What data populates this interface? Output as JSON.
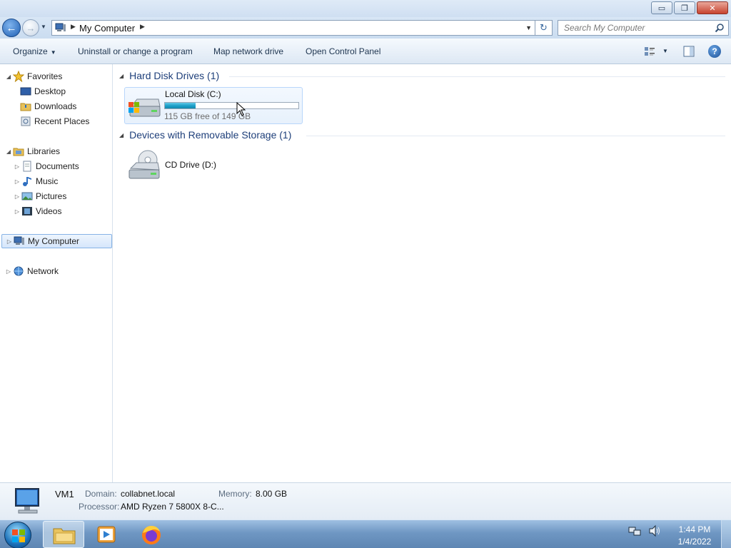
{
  "window": {
    "minimize": "▭",
    "maximize": "❐",
    "close": "✕"
  },
  "address": {
    "location": "My Computer"
  },
  "search": {
    "placeholder": "Search My Computer"
  },
  "toolbar": {
    "organize": "Organize",
    "uninstall": "Uninstall or change a program",
    "map_drive": "Map network drive",
    "control_panel": "Open Control Panel",
    "help": "?"
  },
  "nav": {
    "favorites": "Favorites",
    "desktop": "Desktop",
    "downloads": "Downloads",
    "recent": "Recent Places",
    "libraries": "Libraries",
    "documents": "Documents",
    "music": "Music",
    "pictures": "Pictures",
    "videos": "Videos",
    "computer": "My Computer",
    "network": "Network"
  },
  "groups": {
    "hdd": {
      "title": "Hard Disk Drives (1)",
      "drive_name": "Local Disk (C:)",
      "drive_info": "115 GB free of 149 GB",
      "used_fraction": 0.23
    },
    "removable": {
      "title": "Devices with Removable Storage (1)",
      "drive_name": "CD Drive (D:)"
    }
  },
  "details": {
    "name": "VM1",
    "domain_label": "Domain:",
    "domain": "collabnet.local",
    "memory_label": "Memory:",
    "memory": "8.00 GB",
    "processor_label": "Processor:",
    "processor": "AMD Ryzen 7 5800X 8-C..."
  },
  "taskbar": {
    "time": "1:44 PM",
    "date": "1/4/2022"
  }
}
